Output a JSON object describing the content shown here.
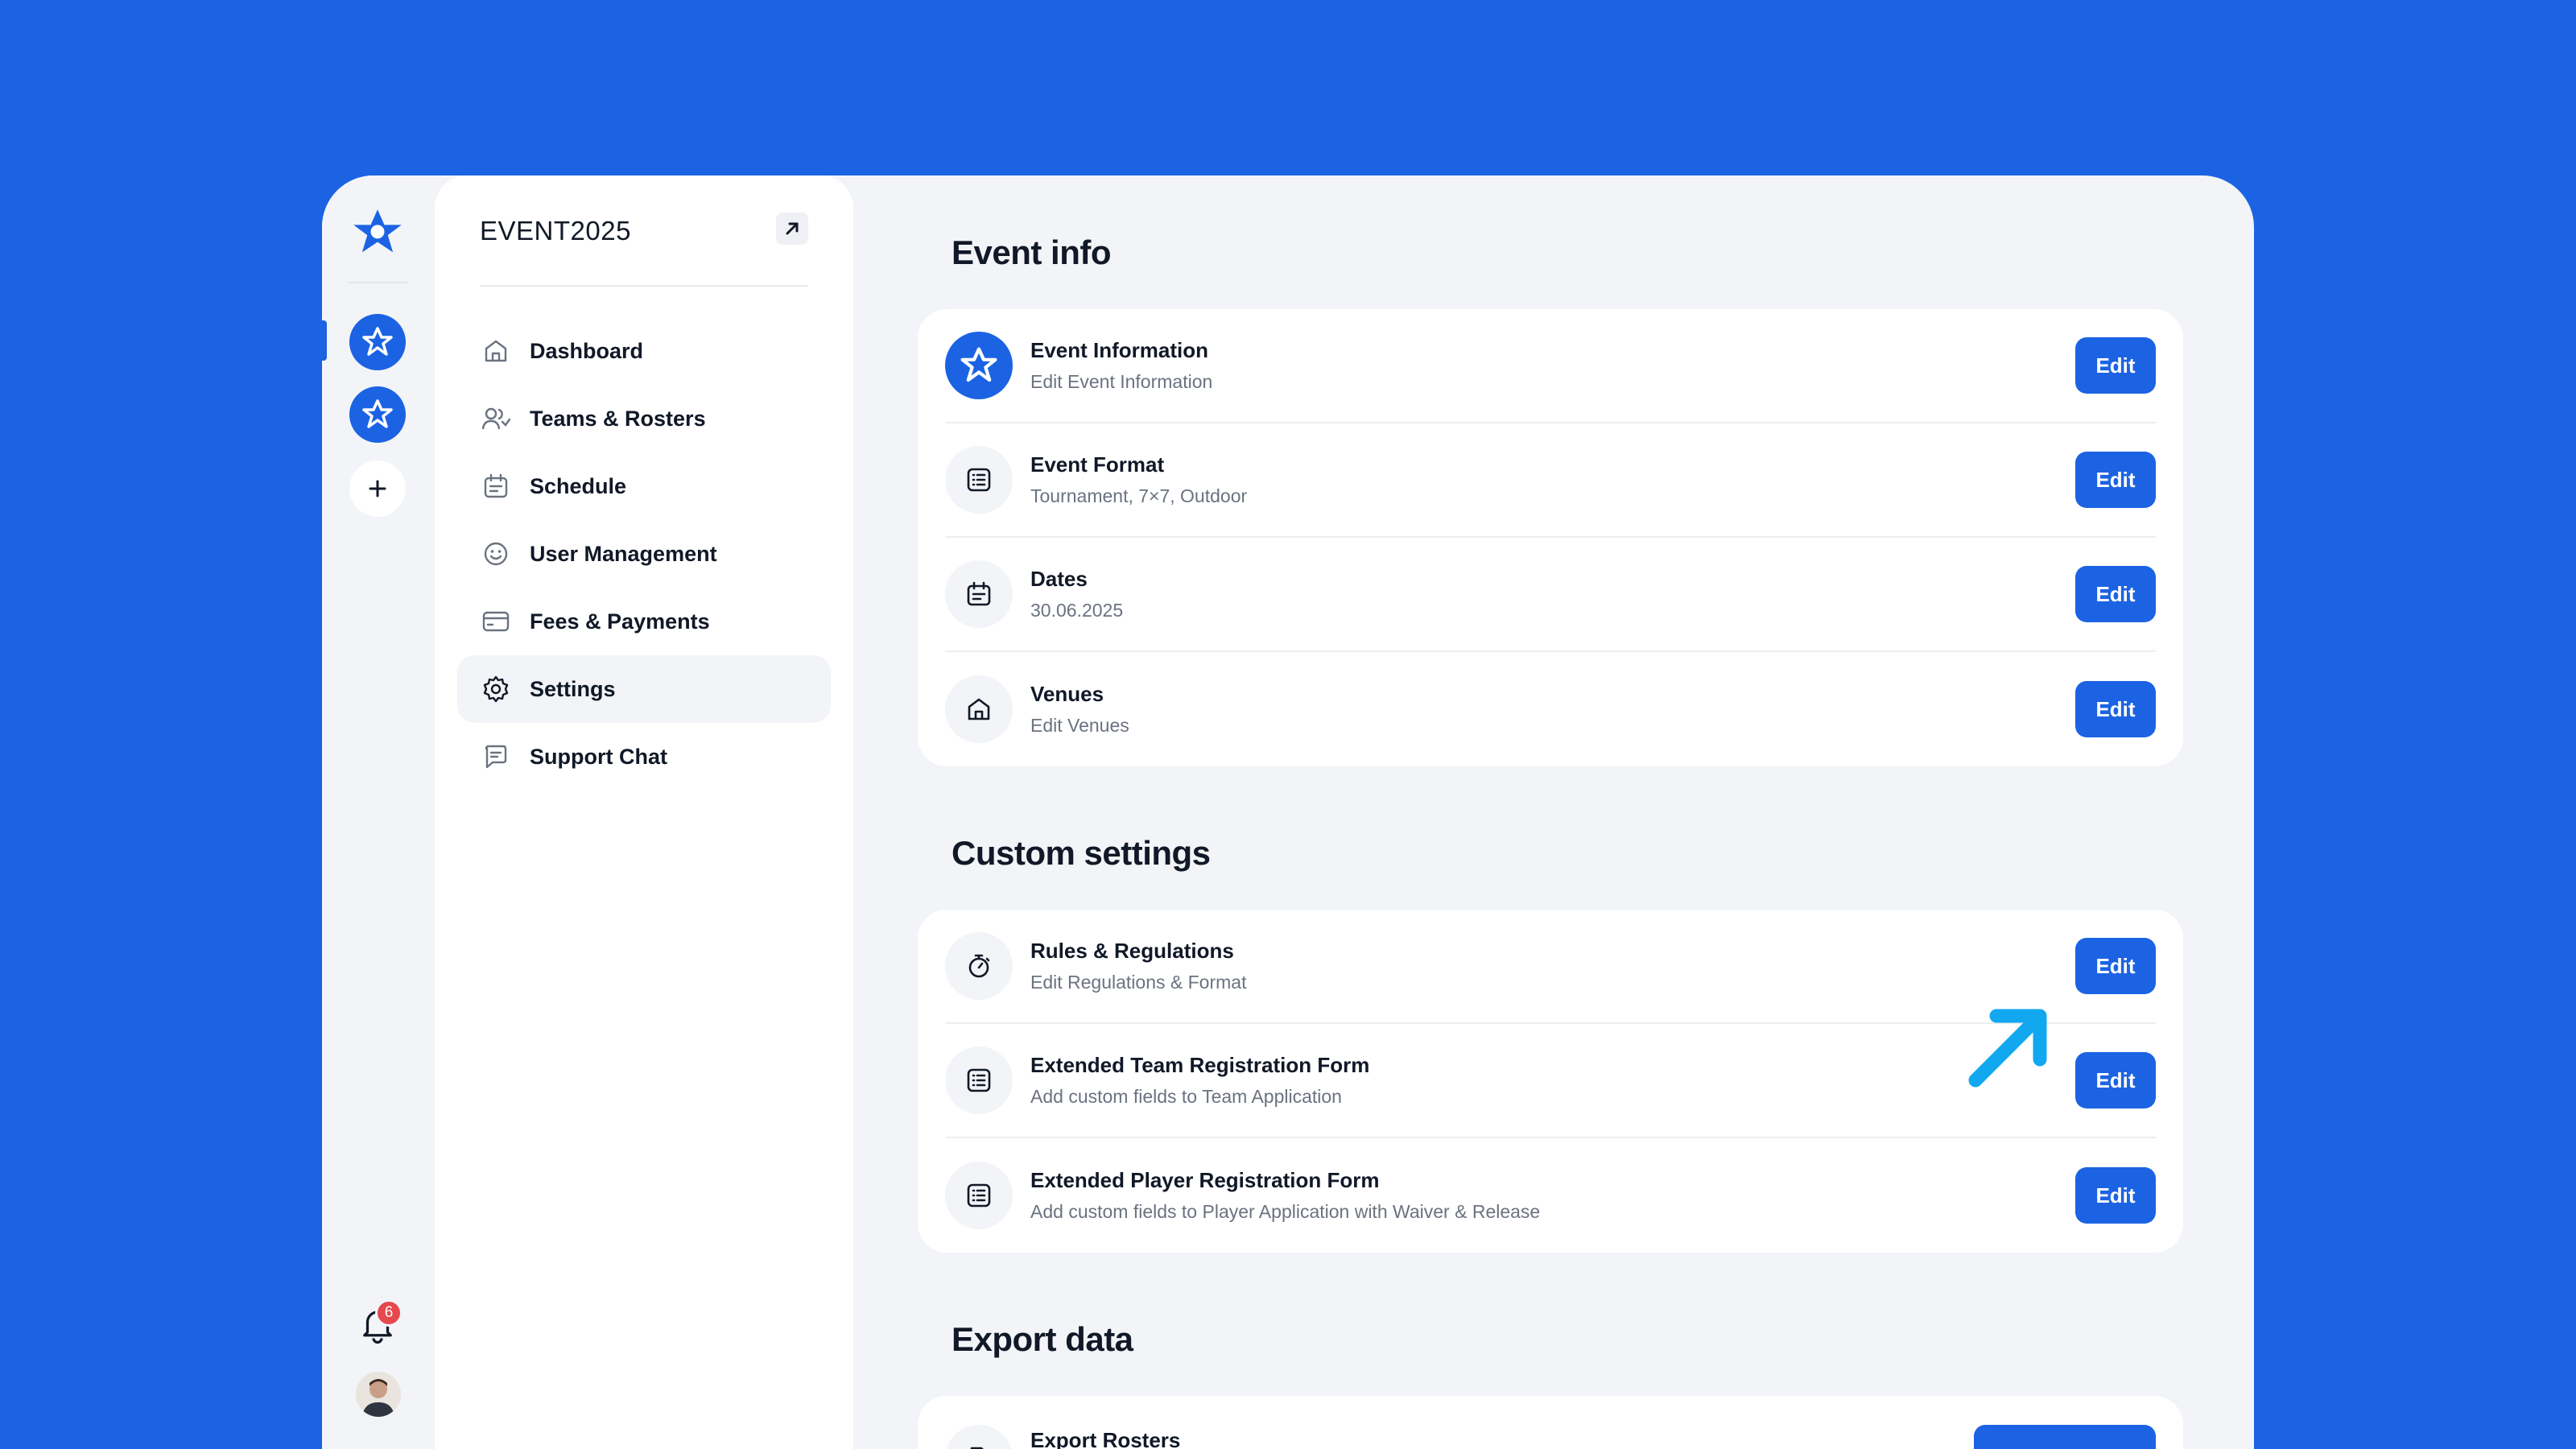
{
  "app": {
    "event_title": "EVENT2025"
  },
  "rail": {
    "notification_count": "6"
  },
  "sidebar": {
    "items": [
      {
        "label": "Dashboard",
        "icon": "home-icon"
      },
      {
        "label": "Teams & Rosters",
        "icon": "users-icon"
      },
      {
        "label": "Schedule",
        "icon": "calendar-icon"
      },
      {
        "label": "User Management",
        "icon": "smile-icon"
      },
      {
        "label": "Fees & Payments",
        "icon": "credit-card-icon"
      },
      {
        "label": "Settings",
        "icon": "gear-icon",
        "active": true
      },
      {
        "label": "Support Chat",
        "icon": "chat-icon"
      }
    ]
  },
  "sections": {
    "event_info": {
      "title": "Event info",
      "rows": [
        {
          "title": "Event Information",
          "subtitle": "Edit Event Information",
          "action": "Edit",
          "icon": "event-logo-icon"
        },
        {
          "title": "Event Format",
          "subtitle": "Tournament, 7×7, Outdoor",
          "action": "Edit",
          "icon": "list-icon"
        },
        {
          "title": "Dates",
          "subtitle": "30.06.2025",
          "action": "Edit",
          "icon": "calendar-icon"
        },
        {
          "title": "Venues",
          "subtitle": "Edit Venues",
          "action": "Edit",
          "icon": "home-icon"
        }
      ]
    },
    "custom_settings": {
      "title": "Custom settings",
      "rows": [
        {
          "title": "Rules & Regulations",
          "subtitle": "Edit Regulations & Format",
          "action": "Edit",
          "icon": "stopwatch-icon"
        },
        {
          "title": "Extended Team Registration Form",
          "subtitle": "Add custom fields to Team Application",
          "action": "Edit",
          "icon": "list-icon"
        },
        {
          "title": "Extended Player Registration Form",
          "subtitle": "Add custom fields to Player Application with Waiver & Release",
          "action": "Edit",
          "icon": "list-icon"
        }
      ]
    },
    "export_data": {
      "title": "Export data",
      "rows": [
        {
          "title": "Export Rosters",
          "icon": "document-icon"
        }
      ]
    }
  },
  "colors": {
    "brand": "#1B63E3",
    "background": "#F2F4F7",
    "text": "#111827",
    "muted": "#6B7280",
    "badge": "#E5484D",
    "arrow": "#12A8F0"
  }
}
